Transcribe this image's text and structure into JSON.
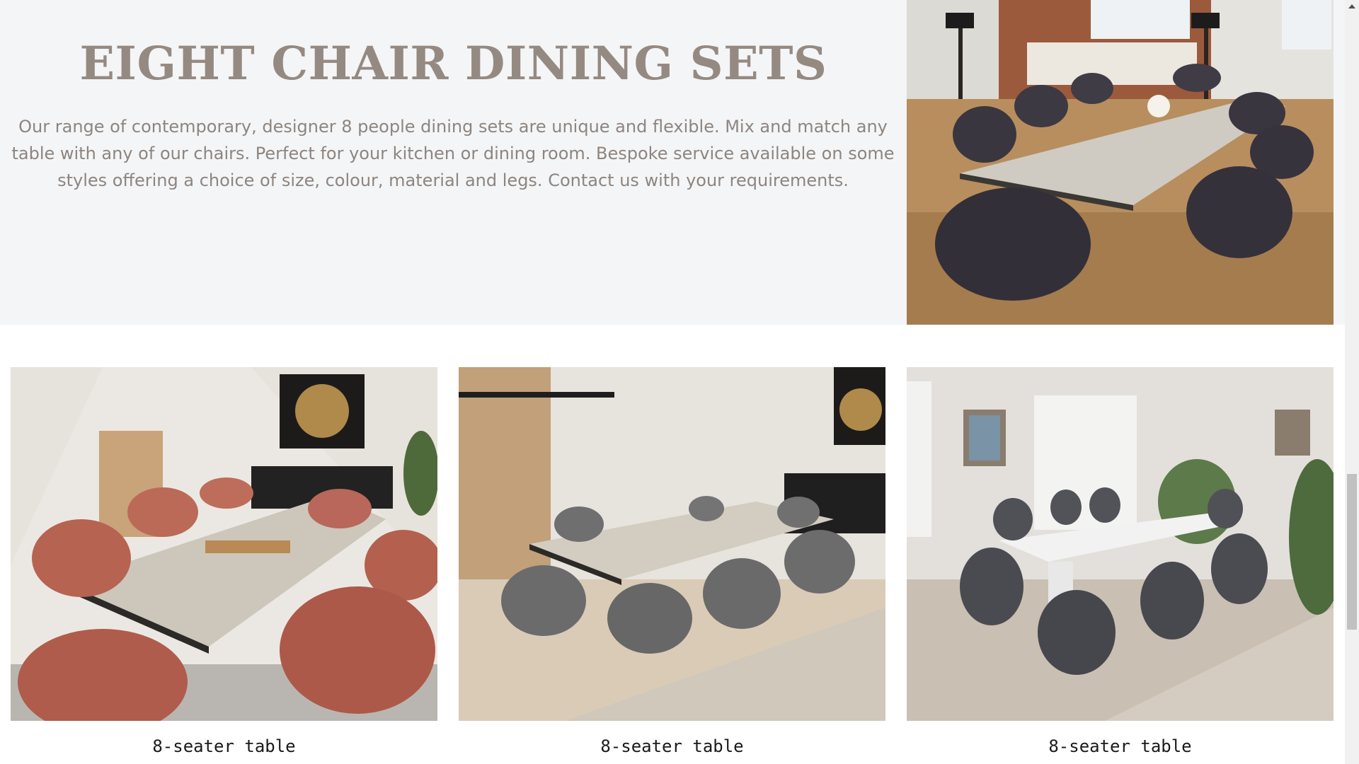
{
  "hero": {
    "title": "EIGHT CHAIR DINING SETS",
    "description": "Our range of contemporary, designer 8 people dining sets are unique and flexible. Mix and match any table with any of our chairs. Perfect for your kitchen or dining room. Bespoke service available on some styles offering a choice of size, colour, material and legs. Contact us with your requirements.",
    "image": "dining-room-photo-purple-chairs"
  },
  "products": [
    {
      "caption": "8-seater table",
      "image": "dining-set-photo-terracotta-chairs"
    },
    {
      "caption": "8-seater table",
      "image": "dining-set-photo-grey-swivel-chairs"
    },
    {
      "caption": "8-seater table",
      "image": "dining-set-photo-white-table-grey-chairs"
    }
  ],
  "colors": {
    "hero_bg": "#f4f5f6",
    "title": "#958a82",
    "body_text": "#8d8580"
  }
}
